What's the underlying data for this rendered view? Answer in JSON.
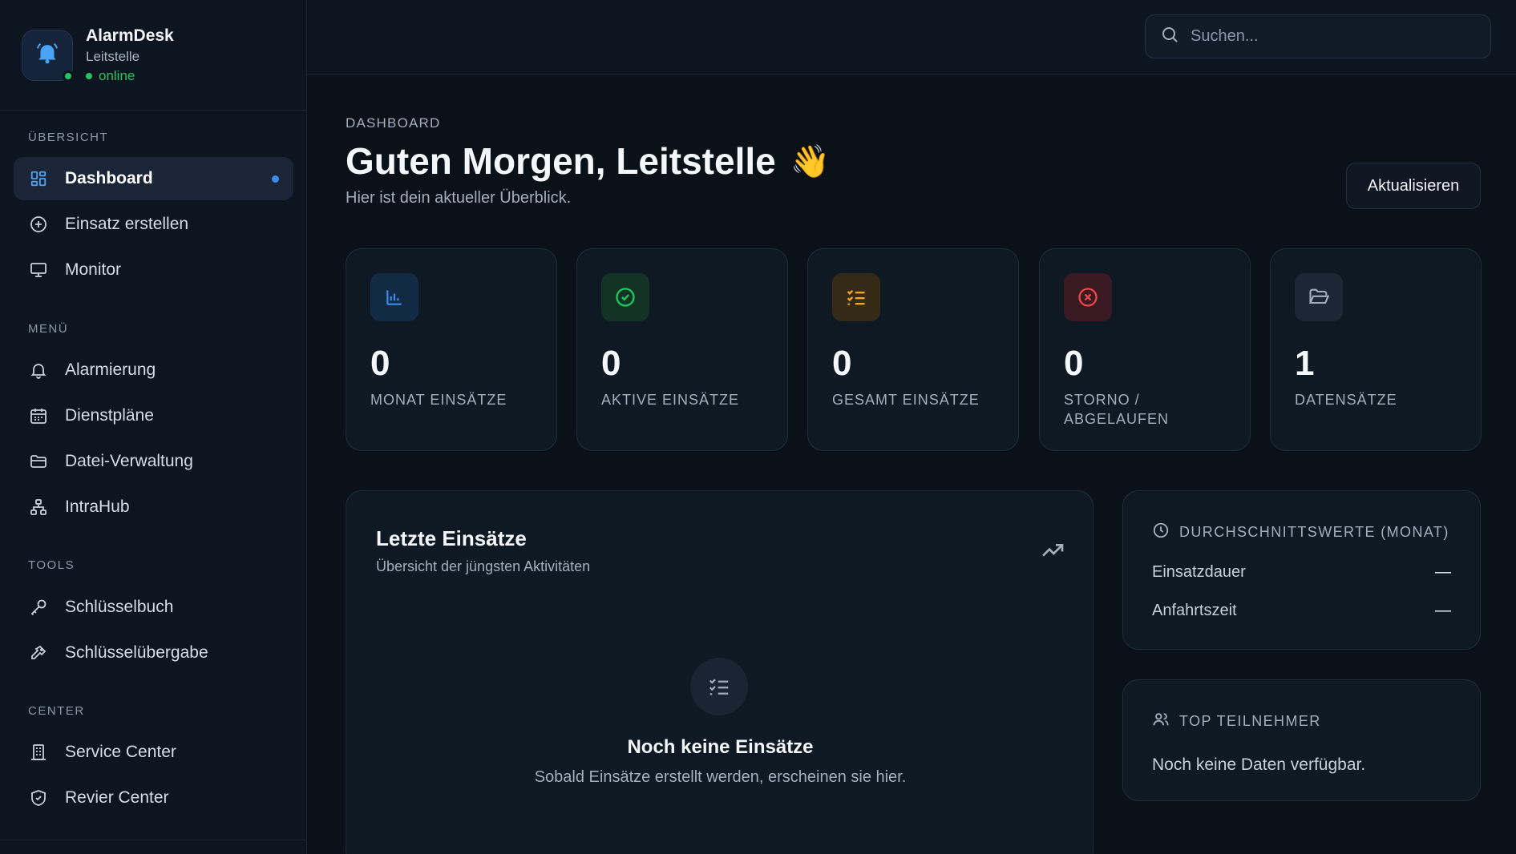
{
  "brand": {
    "title": "AlarmDesk",
    "subtitle": "Leitstelle",
    "status": "online"
  },
  "sidebar": {
    "sections": [
      {
        "title": "ÜBERSICHT",
        "items": [
          {
            "label": "Dashboard",
            "icon": "grid-icon",
            "active": true
          },
          {
            "label": "Einsatz erstellen",
            "icon": "plus-circle-icon"
          },
          {
            "label": "Monitor",
            "icon": "monitor-icon"
          }
        ]
      },
      {
        "title": "MENÜ",
        "items": [
          {
            "label": "Alarmierung",
            "icon": "bell-icon"
          },
          {
            "label": "Dienstpläne",
            "icon": "calendar-icon"
          },
          {
            "label": "Datei-Verwaltung",
            "icon": "folder-icon"
          },
          {
            "label": "IntraHub",
            "icon": "network-icon"
          }
        ]
      },
      {
        "title": "TOOLS",
        "items": [
          {
            "label": "Schlüsselbuch",
            "icon": "key-icon"
          },
          {
            "label": "Schlüsselübergabe",
            "icon": "key-handover-icon"
          }
        ]
      },
      {
        "title": "CENTER",
        "items": [
          {
            "label": "Service Center",
            "icon": "building-icon"
          },
          {
            "label": "Revier Center",
            "icon": "shield-icon"
          }
        ]
      }
    ]
  },
  "search": {
    "placeholder": "Suchen..."
  },
  "header": {
    "breadcrumb": "DASHBOARD",
    "greeting": "Guten Morgen, Leitstelle",
    "emoji": "👋",
    "subtitle": "Hier ist dein aktueller Überblick.",
    "refresh_label": "Aktualisieren"
  },
  "stats": [
    {
      "value": "0",
      "label": "MONAT EINSÄTZE",
      "icon": "bar-chart-icon",
      "color": "#3b8cf0"
    },
    {
      "value": "0",
      "label": "AKTIVE EINSÄTZE",
      "icon": "check-circle-icon",
      "color": "#22c55e"
    },
    {
      "value": "0",
      "label": "GESAMT EINSÄTZE",
      "icon": "list-check-icon",
      "color": "#f5a524"
    },
    {
      "value": "0",
      "label": "STORNO / ABGELAUFEN",
      "icon": "x-circle-icon",
      "color": "#ef4444"
    },
    {
      "value": "1",
      "label": "DATENSÄTZE",
      "icon": "folder-open-icon",
      "color": "#a3afbd"
    }
  ],
  "recent": {
    "title": "Letzte Einsätze",
    "subtitle": "Übersicht der jüngsten Aktivitäten",
    "empty_title": "Noch keine Einsätze",
    "empty_subtitle": "Sobald Einsätze erstellt werden, erscheinen sie hier."
  },
  "averages": {
    "title": "DURCHSCHNITTSWERTE (MONAT)",
    "rows": [
      {
        "label": "Einsatzdauer",
        "value": "—"
      },
      {
        "label": "Anfahrtszeit",
        "value": "—"
      }
    ]
  },
  "top": {
    "title": "TOP TEILNEHMER",
    "empty": "Noch keine Daten verfügbar."
  }
}
